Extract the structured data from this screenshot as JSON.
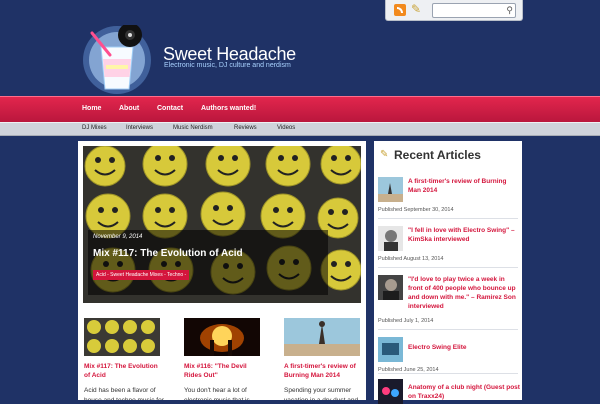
{
  "site": {
    "title": "Sweet Headache",
    "tagline": "Electronic music, DJ culture and nerdism"
  },
  "nav": {
    "items": [
      "Home",
      "About",
      "Contact",
      "Authors wanted!"
    ]
  },
  "subnav": {
    "items": [
      "DJ Mixes",
      "Interviews",
      "Music Nerdism",
      "Reviews",
      "Videos"
    ]
  },
  "hero": {
    "date": "November 9, 2014",
    "title": "Mix #117: The Evolution of Acid",
    "tags": "Acid - Sweet Headache Mixes - Techno -"
  },
  "posts": [
    {
      "title": "Mix #117: The Evolution of Acid",
      "excerpt": "Acid has been a flavor of house and techno music for"
    },
    {
      "title": "Mix #116: \"The Devil Rides Out\"",
      "excerpt": "You don't hear a lot of electronic music that is"
    },
    {
      "title": "A first-timer's review of Burning Man 2014",
      "excerpt": "Spending your summer vacation in a dry dust and"
    }
  ],
  "sidebar": {
    "heading": "Recent Articles",
    "items": [
      {
        "title": "A first-timer's review of Burning Man 2014",
        "meta": "Published September 30, 2014"
      },
      {
        "title": "\"I fell in love with Electro Swing\" – KimSka interviewed",
        "meta": "Published August 13, 2014"
      },
      {
        "title": "\"I'd love to play twice a week in front of 400 people who bounce up and down with me.\" – Ramirez Son interviewed",
        "meta": "Published July 1, 2014"
      },
      {
        "title": "Electro Swing Elite",
        "meta": "Published June 25, 2014"
      },
      {
        "title": "Anatomy of a club night (Guest post on Traxx24)",
        "meta": ""
      }
    ]
  },
  "colors": {
    "background": "#1f3266",
    "accent": "#d4153c",
    "link": "#d4153c"
  },
  "icons": {
    "rss": "rss-icon",
    "write": "pencil-icon",
    "search": "search-icon",
    "heading": "notepad-icon"
  }
}
